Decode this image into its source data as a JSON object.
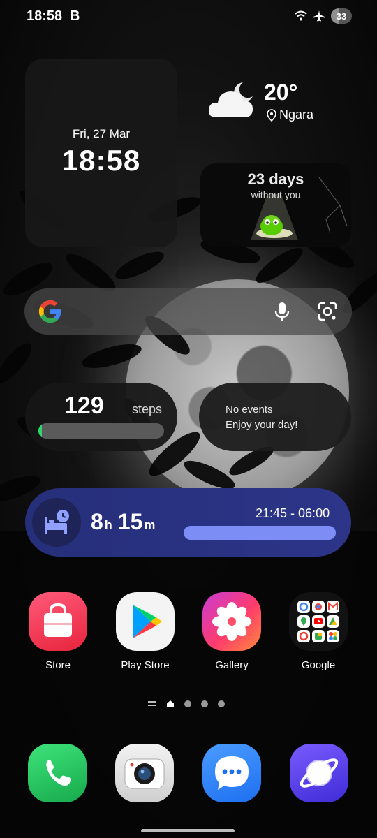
{
  "status_bar": {
    "time": "18:58",
    "indicator": "B",
    "battery": "33",
    "icons": [
      "wifi-icon",
      "airplane-icon",
      "battery-icon"
    ]
  },
  "clock_widget": {
    "date": "Fri, 27 Mar",
    "time": "18:58"
  },
  "weather_widget": {
    "temperature": "20°",
    "location": "Ngara",
    "icon": "cloud-moon-icon"
  },
  "duolingo_widget": {
    "days": "23 days",
    "subtitle": "without you"
  },
  "search_bar": {
    "icons": [
      "google-logo-icon",
      "microphone-icon",
      "lens-icon"
    ]
  },
  "steps_widget": {
    "count": "129",
    "unit": "steps",
    "progress": 0.03,
    "progress_color": "#2fd66a"
  },
  "calendar_widget": {
    "line1": "No events",
    "line2": "Enjoy your day!"
  },
  "sleep_widget": {
    "hours": "8",
    "hours_unit": "h",
    "minutes": "15",
    "minutes_unit": "m",
    "range": "21:45 - 06:00",
    "accent": "#7c8df6"
  },
  "apps": [
    {
      "label": "Store",
      "icon": "store-bag-icon"
    },
    {
      "label": "Play Store",
      "icon": "play-store-icon"
    },
    {
      "label": "Gallery",
      "icon": "gallery-flower-icon"
    },
    {
      "label": "Google",
      "icon": "google-folder-icon"
    }
  ],
  "dock": [
    {
      "name": "phone",
      "icon": "phone-icon"
    },
    {
      "name": "camera",
      "icon": "camera-icon"
    },
    {
      "name": "messages",
      "icon": "messages-icon"
    },
    {
      "name": "internet",
      "icon": "internet-icon"
    }
  ],
  "page_indicator": {
    "pages": 3,
    "current": "home"
  }
}
